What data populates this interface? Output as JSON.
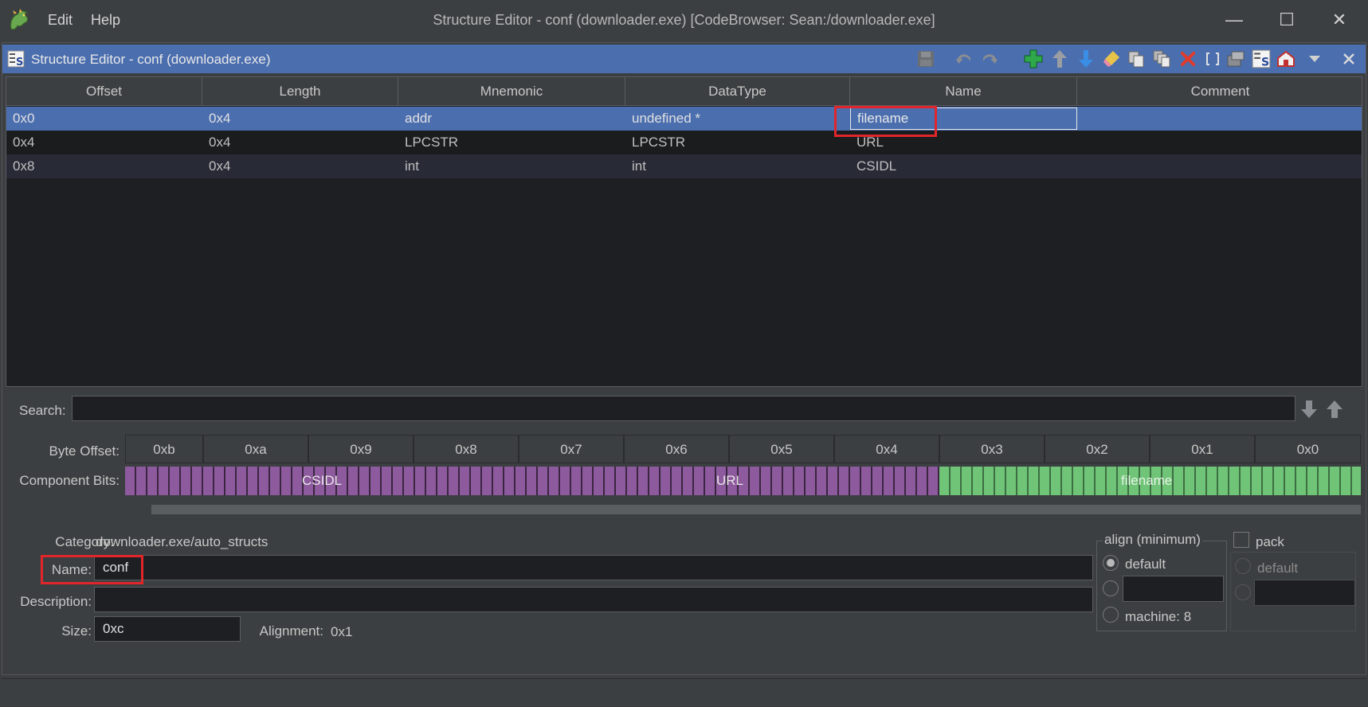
{
  "window": {
    "title": "Structure Editor - conf (downloader.exe) [CodeBrowser: Sean:/downloader.exe]",
    "menu": [
      "Edit",
      "Help"
    ],
    "controls": {
      "minimize": "—",
      "maximize": "☐",
      "close": "✕"
    }
  },
  "component": {
    "title": "Structure Editor - conf (downloader.exe)"
  },
  "toolbar": {
    "icons": [
      "save-icon",
      "undo-icon",
      "redo-icon",
      "insert-icon",
      "move-up-icon",
      "move-down-icon",
      "clear-icon",
      "duplicate-icon",
      "duplicate-multiple-icon",
      "delete-icon",
      "array-icon",
      "unpackage-icon",
      "structure-editor-icon",
      "show-data-type-icon",
      "menu-dropdown-icon",
      "close-icon"
    ]
  },
  "table": {
    "columns": [
      "Offset",
      "Length",
      "Mnemonic",
      "DataType",
      "Name",
      "Comment"
    ],
    "rows": [
      {
        "offset": "0x0",
        "length": "0x4",
        "mnemonic": "addr",
        "datatype": "undefined *",
        "name": "filename",
        "comment": ""
      },
      {
        "offset": "0x4",
        "length": "0x4",
        "mnemonic": "LPCSTR",
        "datatype": "LPCSTR",
        "name": "URL",
        "comment": ""
      },
      {
        "offset": "0x8",
        "length": "0x4",
        "mnemonic": "int",
        "datatype": "int",
        "name": "CSIDL",
        "comment": ""
      }
    ]
  },
  "search": {
    "label": "Search:",
    "value": ""
  },
  "bitviewer": {
    "byte_offset_label": "Byte Offset:",
    "component_bits_label": "Component Bits:",
    "bytes": [
      "0xb",
      "0xa",
      "0x9",
      "0x8",
      "0x7",
      "0x6",
      "0x5",
      "0x4",
      "0x3",
      "0x2",
      "0x1",
      "0x0"
    ],
    "components": [
      {
        "name": "CSIDL",
        "color": "#8e5a9e"
      },
      {
        "name": "URL",
        "color": "#8e5a9e"
      },
      {
        "name": "filename",
        "color": "#70c477"
      }
    ]
  },
  "info": {
    "category_label": "Category:",
    "category_value": "downloader.exe/auto_structs",
    "name_label": "Name:",
    "name_value": "conf",
    "description_label": "Description:",
    "description_value": "",
    "size_label": "Size:",
    "size_value": "0xc",
    "alignment_label": "Alignment:",
    "alignment_value": "0x1"
  },
  "align": {
    "title": "align (minimum)",
    "default_label": "default",
    "machine_label": "machine: 8",
    "selected": "default"
  },
  "pack": {
    "label": "pack",
    "checked": false,
    "default_label": "default"
  },
  "highlight_color": "#e0262a",
  "selection_color": "#4b6eaf"
}
